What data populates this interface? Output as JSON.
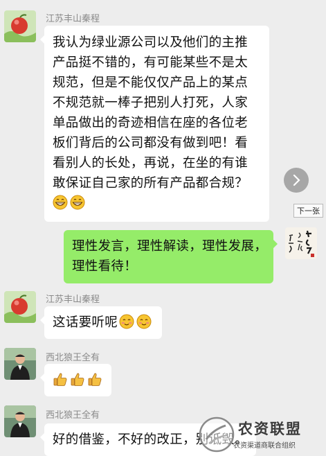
{
  "messages": [
    {
      "sender": "江苏丰山秦程",
      "lines": [
        "我认为绿业源公司以及他们的主推",
        "产品挺不错的，有可能某些不是太",
        "规范，但是不能仅仅产品上的某点",
        "不规范就一棒子把别人打死，人家",
        "单品做出的奇迹相信在座的各位老",
        "板们背后的公司都没有做到吧！看",
        "看别人的长处，再说，在坐的有谁",
        "敢保证自己家的所有产品都合规？"
      ],
      "emojis": [
        "grin-emoji",
        "grin-emoji"
      ]
    },
    {
      "sender": "",
      "lines": [
        "理性发言，理性解读，理性发展，",
        "理性看待！"
      ]
    },
    {
      "sender": "江苏丰山秦程",
      "lines": [
        "这话要听呢"
      ],
      "emojis": [
        "blush-emoji",
        "blush-emoji"
      ]
    },
    {
      "sender": "西北狼王全有",
      "emojis": [
        "thumbs-up-emoji",
        "thumbs-up-emoji",
        "thumbs-up-emoji"
      ]
    },
    {
      "sender": "西北狼王全有",
      "lines": [
        "好的借鉴，不好的改正，别诋毁。"
      ]
    }
  ],
  "viewer": {
    "next_tooltip": "下一张",
    "next_icon": "chevron-right-icon"
  },
  "watermark": {
    "title": "农资联盟",
    "subtitle": "农资渠道商联合组织"
  },
  "colors": {
    "background": "#ededed",
    "bubble_in": "#ffffff",
    "bubble_out": "#95ec69",
    "sender_name": "#8a8a8a"
  }
}
